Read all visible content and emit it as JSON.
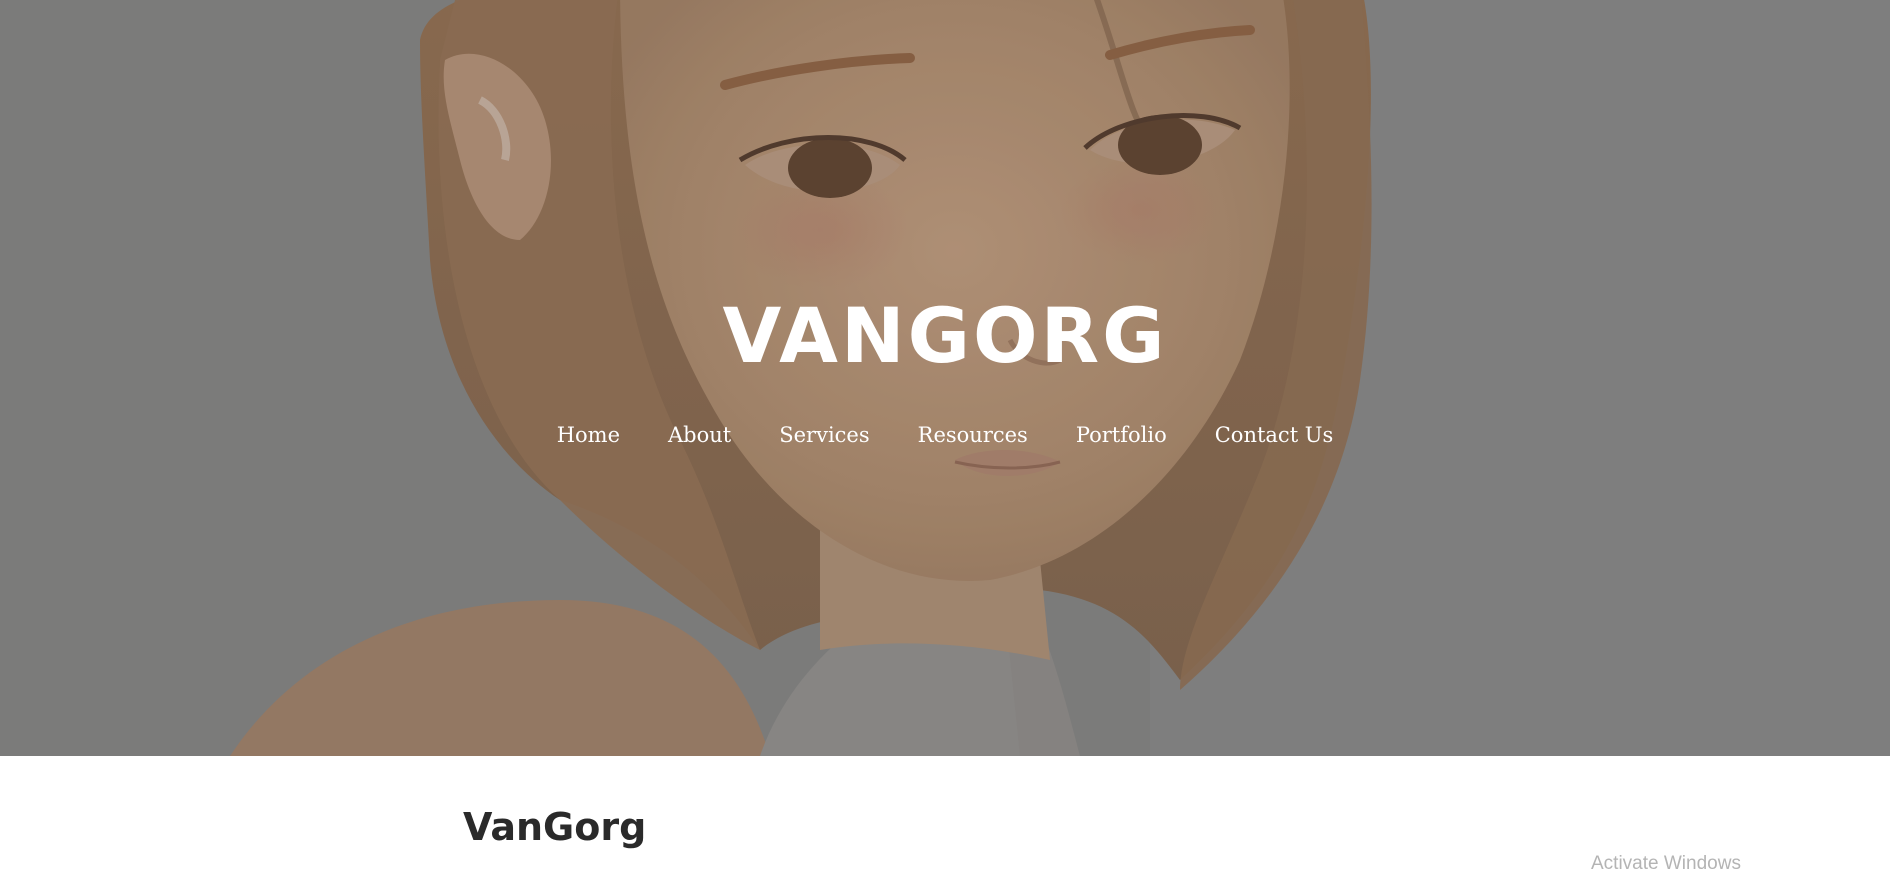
{
  "site": {
    "title": "VANGORG"
  },
  "nav": {
    "items": [
      {
        "label": "Home"
      },
      {
        "label": "About"
      },
      {
        "label": "Services"
      },
      {
        "label": "Resources"
      },
      {
        "label": "Portfolio"
      },
      {
        "label": "Contact Us"
      }
    ]
  },
  "content": {
    "heading": "VanGorg"
  },
  "system": {
    "watermark": "Activate Windows"
  },
  "colors": {
    "hero_overlay": "#808080",
    "title_text": "#ffffff",
    "heading_text": "#2a2a2a",
    "watermark_text": "#b4b4b4"
  }
}
